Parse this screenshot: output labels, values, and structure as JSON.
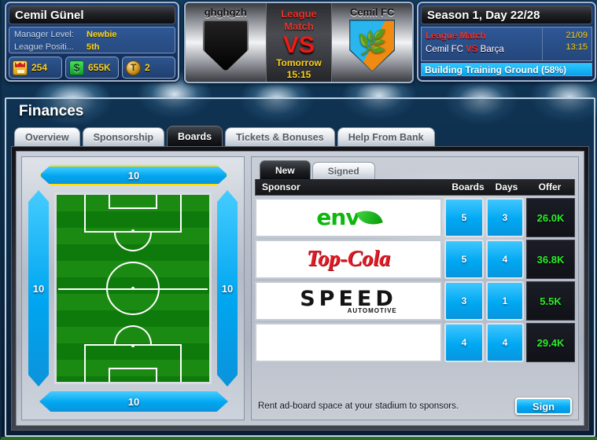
{
  "manager": {
    "name": "Cemil Günel",
    "level_label": "Manager Level:",
    "level_value": "Newbie",
    "position_label": "League Positi...",
    "position_value": "5th",
    "resources": [
      {
        "icon": "trophy-icon",
        "value": "254"
      },
      {
        "icon": "money-icon",
        "value": "655K"
      },
      {
        "icon": "token-icon",
        "value": "2"
      }
    ]
  },
  "match": {
    "home_team": "ghghgzh",
    "away_team": "Cemil FC",
    "type_line1": "League",
    "type_line2": "Match",
    "vs": "VS",
    "day": "Tomorrow",
    "time": "15:15"
  },
  "season": {
    "title": "Season 1, Day 22/28",
    "event_type": "League Match",
    "event_home": "Cemil FC",
    "event_vs": "VS",
    "event_away": "Barça",
    "event_date": "21/09",
    "event_time": "13:15",
    "build_status": "Building Training Ground (58%)"
  },
  "window": {
    "title": "Finances",
    "tabs": [
      {
        "label": "Overview",
        "active": false
      },
      {
        "label": "Sponsorship",
        "active": false
      },
      {
        "label": "Boards",
        "active": true
      },
      {
        "label": "Tickets & Bonuses",
        "active": false
      },
      {
        "label": "Help From Bank",
        "active": false
      }
    ]
  },
  "stadium": {
    "boards": {
      "top": {
        "count": "10",
        "selected": true
      },
      "right": {
        "count": "10",
        "selected": false
      },
      "bottom": {
        "count": "10",
        "selected": false
      },
      "left": {
        "count": "10",
        "selected": false
      }
    }
  },
  "sponsors": {
    "sub_tabs": [
      {
        "label": "New",
        "active": true
      },
      {
        "label": "Signed",
        "active": false
      }
    ],
    "columns": {
      "sponsor": "Sponsor",
      "boards": "Boards",
      "days": "Days",
      "offer": "Offer"
    },
    "rows": [
      {
        "logo": "env-logo",
        "name": "env",
        "boards": "5",
        "days": "3",
        "offer": "26.0K"
      },
      {
        "logo": "cola-logo",
        "name": "Top-Cola",
        "boards": "5",
        "days": "4",
        "offer": "36.8K"
      },
      {
        "logo": "speed-logo",
        "name": "SPEED",
        "sub": "AUTOMOTIVE",
        "boards": "3",
        "days": "1",
        "offer": "5.5K"
      },
      {
        "logo": "blank-logo",
        "name": "",
        "boards": "4",
        "days": "4",
        "offer": "29.4K"
      }
    ],
    "footer_note": "Rent ad-board space at your stadium to sponsors.",
    "sign_button": "Sign"
  },
  "colors": {
    "accent_blue": "#00a8f3",
    "offer_green": "#2aee2a",
    "highlight_yellow": "#ffe000",
    "match_red": "#ee1b14",
    "gold_text": "#ffd21a"
  }
}
